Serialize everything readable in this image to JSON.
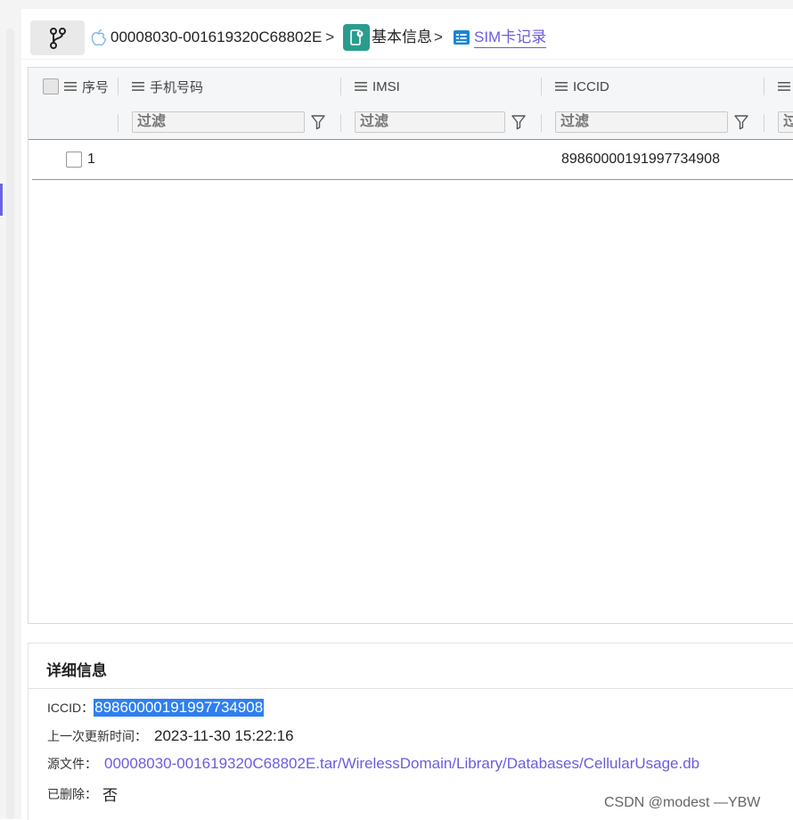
{
  "breadcrumb": {
    "device": "00008030-001619320C68802E",
    "basic_info": "基本信息",
    "current": "SIM卡记录",
    "separator": ">"
  },
  "table": {
    "columns": {
      "seq": "序号",
      "phone": "手机号码",
      "imsi": "IMSI",
      "iccid": "ICCID"
    },
    "filter_placeholder": "过滤",
    "rows": [
      {
        "seq": "1",
        "phone": "",
        "imsi": "",
        "iccid": "89860000191997734908"
      }
    ]
  },
  "detail": {
    "title": "详细信息",
    "iccid_label": "ICCID：",
    "iccid_value": "89860000191997734908",
    "updated_label": "上一次更新时间：",
    "updated_value": "2023-11-30 15:22:16",
    "source_label": "源文件：",
    "source_value": "00008030-001619320C68802E.tar/WirelessDomain/Library/Databases/CellularUsage.db",
    "deleted_label": "已删除：",
    "deleted_value": "否"
  },
  "watermark": "CSDN @modest —YBW",
  "icons": [
    "branch-icon",
    "apple-icon",
    "phone-info-icon",
    "sim-record-icon",
    "list-icon",
    "filter-icon"
  ],
  "colors": {
    "accent": "#6a5ce0",
    "teal": "#2a9c8e",
    "selection": "#2e7ff0",
    "sim_icon": "#1a86d6"
  }
}
